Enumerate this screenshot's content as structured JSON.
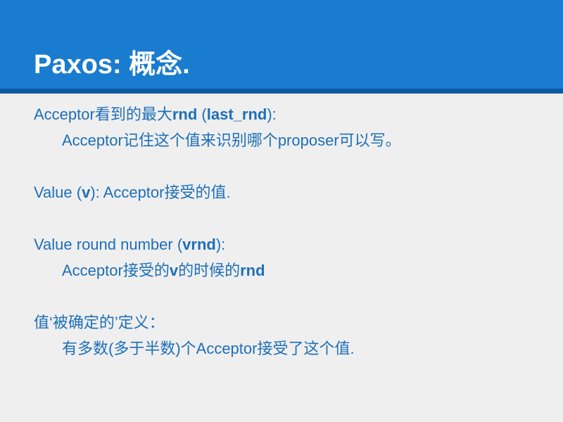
{
  "slide": {
    "title": "Paxos: 概念.",
    "items": [
      {
        "heading": [
          "Acceptor看到的最大",
          "rnd",
          " (",
          "last_rnd",
          "):"
        ],
        "detail": [
          "Acceptor记住这个值来识别哪个proposer可以写。"
        ]
      },
      {
        "heading": [
          "Value (",
          "v",
          "): Acceptor接受的值."
        ]
      },
      {
        "heading": [
          "Value round number (",
          "vrnd",
          "):"
        ],
        "detail": [
          "Acceptor接受的",
          "v",
          "的时候的",
          "rnd"
        ]
      },
      {
        "heading": [
          "值‘被确定的’定义："
        ],
        "detail": [
          "有多数(多于半数)个Acceptor接受了这个值."
        ]
      }
    ]
  }
}
